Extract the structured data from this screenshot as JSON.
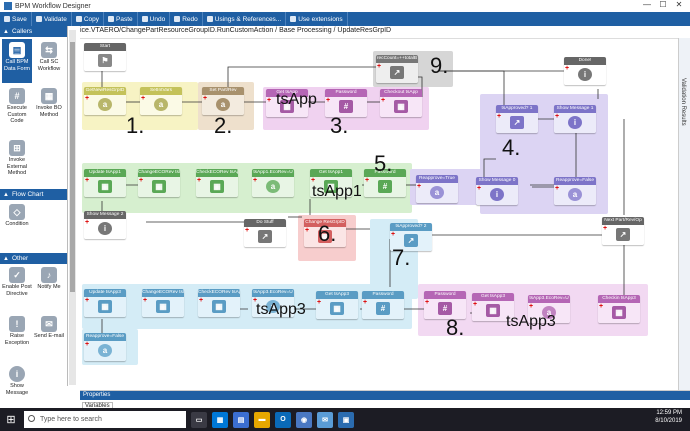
{
  "window": {
    "title": "BPM Workflow Designer",
    "min": "—",
    "max": "☐",
    "close": "✕"
  },
  "toolbar": {
    "save": "Save",
    "validate": "Validate",
    "copy": "Copy",
    "paste": "Paste",
    "undo": "Undo",
    "redo": "Redo",
    "usings": "Usings & References...",
    "extensions": "Use extensions"
  },
  "path": "ice.VTAERO/ChangePartResourceGroupID.RunCustomAction / Base Processing / UpdateResGrpID",
  "sidebar": {
    "callers_title": "Callers",
    "callers": [
      "Call BPM Data Form",
      "Call SC Workflow",
      "Execute Custom Code",
      "Invoke BO Method",
      "Invoke External Method"
    ],
    "flow_title": "Flow Chart",
    "flow": [
      "Condition"
    ],
    "other_title": "Other",
    "other": [
      "Enable Post Directive",
      "Notify Me",
      "Raise Exception",
      "Send E-mail",
      "Show Message"
    ]
  },
  "nodes": {
    "start": "Start",
    "getnew": "GetNewResGrpID",
    "setintvar": "SetIntVars",
    "setpart": "Set Part/Rev",
    "gettsapp": "Get tsApp",
    "password1": "Password",
    "checkout1": "Checkout tsApp",
    "recount": "recCount=++totalB",
    "done": "Done!",
    "tsapproved1": "tsApproved? 1",
    "showmsg1": "Show Message 1",
    "reapfalse1": "Reapprove=False",
    "reaptrue": "Reapprove=True",
    "showmsg0": "Show Message 0",
    "update1": "Update tsApp1",
    "changeeco1": "ChangeECORev tsl",
    "checkeco1": "CheckECORev tsAp",
    "ecorev1": "tsApp1.EcoRev=U",
    "gettsapp1": "Get tsApp1",
    "password2": "Password",
    "showmsg2": "Show Message 2",
    "dostuff": "Do Stuff",
    "changeres": "Change ResGrpID",
    "tsapproved2": "tsApproved? 2",
    "nextpart": "Next Part/Rev/Op",
    "update3": "Update tsApp3",
    "changeeco3": "ChangeECORev tsl",
    "checkeco3": "CheckECORev tsAp",
    "ecorev3": "tsApp3.EcoRev=U",
    "gettsapp3a": "Get tsApp3",
    "password3": "Password",
    "reapfalse3": "Reapprove=False",
    "password4": "Password",
    "gettsapp3b": "Get tsApp3",
    "ecorev3b": "tsApp3.EcoRev=U",
    "checkin": "Checkin tsApp3"
  },
  "annotations": {
    "n1": "1.",
    "n2": "2.",
    "n3": "3.",
    "n4": "4.",
    "n5": "5.",
    "n6": "6.",
    "n7": "7.",
    "n8": "8.",
    "n9": "9.",
    "tsapp": "tsApp",
    "tsapp1": "tsApp1",
    "tsapp3a": "tsApp3",
    "tsapp3b": "tsApp3"
  },
  "validation_tab": "Validation Results",
  "properties": {
    "title": "Properties",
    "tab": "Variables"
  },
  "taskbar": {
    "search_placeholder": "Type here to search",
    "time": "12:59 PM",
    "date": "8/10/2019"
  }
}
